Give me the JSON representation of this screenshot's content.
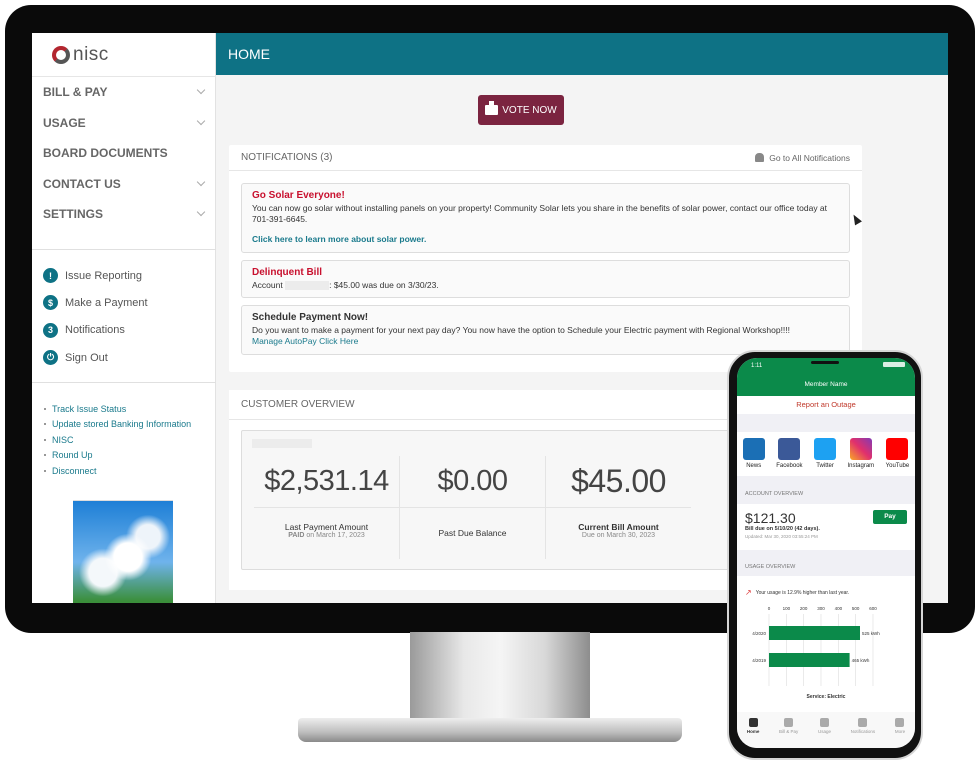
{
  "brand": {
    "logo_text": "nisc"
  },
  "header": {
    "title": "HOME"
  },
  "sidebar": {
    "nav": [
      {
        "label": "BILL & PAY",
        "expandable": true
      },
      {
        "label": "USAGE",
        "expandable": true
      },
      {
        "label": "BOARD DOCUMENTS",
        "expandable": false
      },
      {
        "label": "CONTACT US",
        "expandable": true
      },
      {
        "label": "SETTINGS",
        "expandable": true
      }
    ],
    "quick": [
      {
        "label": "Issue Reporting",
        "icon": "!"
      },
      {
        "label": "Make a Payment",
        "icon": "$"
      },
      {
        "label": "Notifications",
        "icon": "3"
      },
      {
        "label": "Sign Out",
        "icon": "⏻"
      }
    ],
    "links": [
      "Track Issue Status",
      "Update stored Banking Information",
      "NISC",
      "Round Up",
      "Disconnect"
    ]
  },
  "vote_label": "VOTE NOW",
  "notifications": {
    "title": "NOTIFICATIONS (3)",
    "go_all": "Go to All Notifications",
    "items": [
      {
        "title": "Go Solar Everyone!",
        "body": "You can now go solar without installing panels on your property! Community Solar lets you share in the benefits of solar power, contact our office today at 701-391-6645.",
        "link": "Click here to learn more about solar power."
      },
      {
        "title": "Delinquent Bill",
        "body_prefix": "Account",
        "body": ": $45.00 was due on 3/30/23."
      },
      {
        "title": "Schedule Payment Now!",
        "body": "Do you want to make a payment for your next pay day? You now have the option to Schedule your Electric payment with Regional Workshop!!!!",
        "link": "Manage AutoPay Click Here"
      }
    ]
  },
  "overview": {
    "title": "CUSTOMER OVERVIEW",
    "cols": [
      {
        "amount": "$2,531.14",
        "label": "Last Payment Amount",
        "sub_bold": "PAID",
        "sub": " on March 17, 2023"
      },
      {
        "amount": "$0.00",
        "label": "Past Due Balance"
      },
      {
        "amount": "$45.00",
        "label": "Current Bill Amount",
        "sub": "Due on March 30, 2023"
      }
    ]
  },
  "phone": {
    "time": "1:11",
    "member": "Member Name",
    "outage": "Report an Outage",
    "social": [
      "News",
      "Facebook",
      "Twitter",
      "Instagram",
      "YouTube"
    ],
    "account_title": "ACCOUNT OVERVIEW",
    "amount": "$121.30",
    "due": "Bill due on 5/10/20 (42 days).",
    "updated": "Updated: Mar 30, 2020 03:55:24 PM",
    "pay": "Pay",
    "usage_title": "USAGE OVERVIEW",
    "usage_note": "Your usage is 12.9% higher than last year.",
    "chart_data": {
      "type": "bar",
      "orientation": "horizontal",
      "categories": [
        "4/2020",
        "4/2019"
      ],
      "values": [
        525,
        465
      ],
      "data_labels": [
        "525 kWh",
        "465 kWh"
      ],
      "xticks": [
        "0",
        "100",
        "200",
        "300",
        "400",
        "500",
        "600"
      ],
      "xlim": [
        0,
        600
      ],
      "caption": "Service: Electric",
      "color": "#0b8a4a"
    },
    "tabs": [
      "Home",
      "Bill & Pay",
      "Usage",
      "Notifications",
      "More"
    ]
  }
}
